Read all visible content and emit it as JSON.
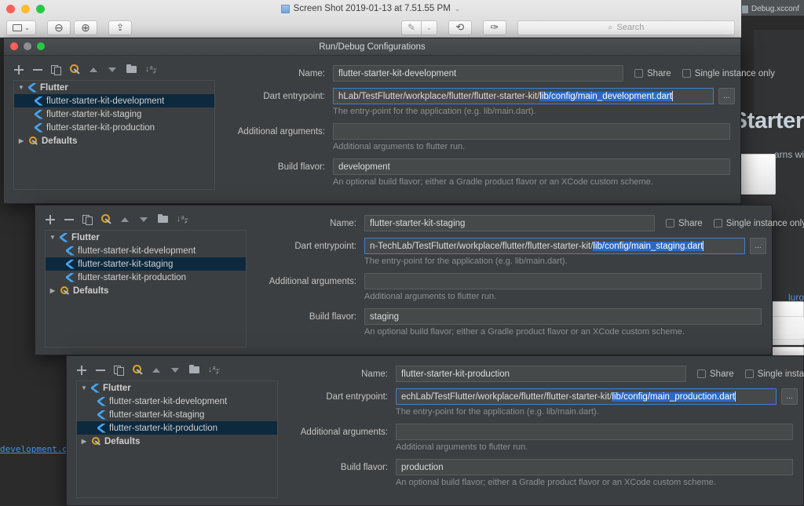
{
  "background": {
    "ide_tab_label": "Debug.xcconf",
    "big_title": "Starter",
    "sub_text": "arns wi",
    "link_text": "luro",
    "code_line": "development.da"
  },
  "preview_window": {
    "title": "Screen Shot 2019-01-13 at 7.51.55 PM",
    "title_chevron": "⌄",
    "toolbar": {
      "sidebar_label": "▯",
      "sidebar_chevron": "⌄",
      "zoom_out": "⊖",
      "zoom_in": "⊕",
      "share": "⇪",
      "markup": "✎",
      "markup_chevron": "⌄",
      "rotate": "⟲",
      "annotate": "✑"
    },
    "search": {
      "placeholder": "Search",
      "icon": "⌕"
    }
  },
  "dialog_title": "Run/Debug Configurations",
  "toolbar_icons": [
    "add-icon",
    "remove-icon",
    "copy-icon",
    "edit-templates-icon",
    "move-up-icon",
    "move-down-icon",
    "folder-icon",
    "sort-icon"
  ],
  "sort_glyph": "↓ᵃ𝓏",
  "tree": {
    "root_label": "Flutter",
    "root_triangle": "▼",
    "defaults_label": "Defaults",
    "defaults_triangle": "▶",
    "items": [
      "flutter-starter-kit-development",
      "flutter-starter-kit-staging",
      "flutter-starter-kit-production"
    ]
  },
  "labels": {
    "name": "Name:",
    "dart_entrypoint": "Dart entrypoint:",
    "additional_arguments": "Additional arguments:",
    "build_flavor": "Build flavor:",
    "share": "Share",
    "single_instance_only": "Single instance only",
    "ellipsis": "...",
    "hint_entrypoint": "The entry-point for the application (e.g. lib/main.dart).",
    "hint_arguments": "Additional arguments to flutter run.",
    "hint_flavor": "An optional build flavor; either a Gradle product flavor or an XCode custom scheme."
  },
  "configs": [
    {
      "selected_index": 0,
      "name": "flutter-starter-kit-development",
      "entrypoint_prefix": "hLab/TestFlutter/workplace/flutter/flutter-starter-kit/",
      "entrypoint_selected": "lib/config/main_development.dart",
      "additional_arguments": "",
      "build_flavor": "development"
    },
    {
      "selected_index": 1,
      "name": "flutter-starter-kit-staging",
      "entrypoint_prefix": "n-TechLab/TestFlutter/workplace/flutter/flutter-starter-kit/",
      "entrypoint_selected": "lib/config/main_staging.dart",
      "additional_arguments": "",
      "build_flavor": "staging"
    },
    {
      "selected_index": 2,
      "name": "flutter-starter-kit-production",
      "entrypoint_prefix": "echLab/TestFlutter/workplace/flutter/flutter-starter-kit/",
      "entrypoint_selected": "lib/config/main_production.dart",
      "additional_arguments": "",
      "build_flavor": "production"
    }
  ],
  "colors": {
    "dialog_bg": "#3c3f41",
    "selection_blue": "#2a69c8",
    "tree_selection": "#0d293e",
    "flutter_blue": "#42a5f5",
    "focus_border": "#3d7fd1"
  }
}
